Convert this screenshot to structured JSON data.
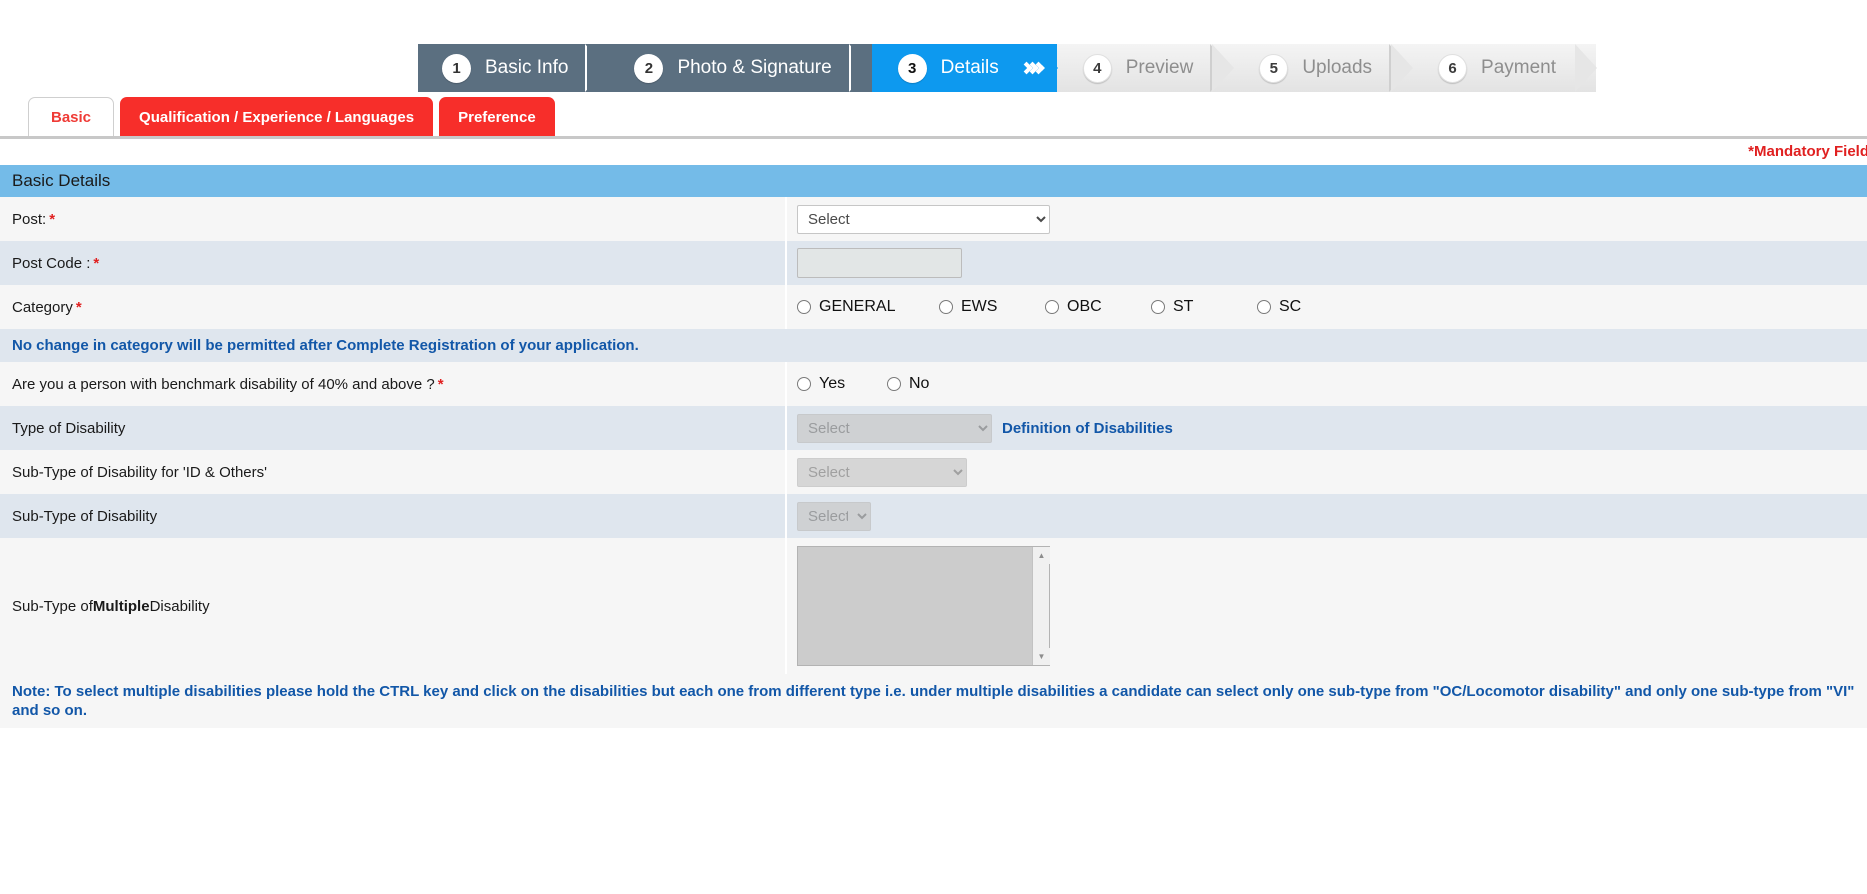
{
  "wizard": {
    "steps": [
      {
        "num": "1",
        "label": "Basic Info",
        "state": "done"
      },
      {
        "num": "2",
        "label": "Photo & Signature",
        "state": "done"
      },
      {
        "num": "3",
        "label": "Details",
        "state": "active"
      },
      {
        "num": "4",
        "label": "Preview",
        "state": "todo"
      },
      {
        "num": "5",
        "label": "Uploads",
        "state": "todo"
      },
      {
        "num": "6",
        "label": "Payment",
        "state": "todo"
      }
    ],
    "active_color": "#0d99ef",
    "done_color": "#5b6f80"
  },
  "tabs": [
    {
      "label": "Basic",
      "active": true
    },
    {
      "label": "Qualification / Experience / Languages",
      "active": false
    },
    {
      "label": "Preference",
      "active": false
    }
  ],
  "mandatory_note": "*Mandatory Field",
  "section": {
    "title": "Basic Details",
    "header_color": "#74bbe8"
  },
  "fields": {
    "post": {
      "label": "Post:",
      "required": "*",
      "selected": "Select",
      "options": [
        "Select"
      ]
    },
    "post_code": {
      "label": "Post Code :",
      "required": "*",
      "value": ""
    },
    "category": {
      "label": "Category",
      "required": "*",
      "options": [
        "GENERAL",
        "EWS",
        "OBC",
        "ST",
        "SC"
      ],
      "selected": ""
    },
    "category_note": "No change in category will be permitted after Complete Registration of your application.",
    "benchmark_disability": {
      "label": "Are you a person with benchmark disability of 40% and above ?",
      "required": "*",
      "options": [
        "Yes",
        "No"
      ],
      "selected": ""
    },
    "type_of_disability": {
      "label": "Type of Disability",
      "selected": "Select",
      "disabled": true,
      "link": "Definition of Disabilities"
    },
    "sub_type_id_others": {
      "label": "Sub-Type of Disability for 'ID & Others'",
      "selected": "Select",
      "disabled": true
    },
    "sub_type_disability": {
      "label": "Sub-Type of Disability",
      "selected": "Select",
      "disabled": true
    },
    "sub_type_multiple": {
      "label_pre": "Sub-Type of ",
      "label_bold": "Multiple",
      "label_post": " Disability",
      "items": []
    }
  },
  "bottom_note": "Note: To select multiple disabilities please hold the CTRL key and click on the disabilities but each one from different type i.e. under multiple disabilities a candidate can select only one sub-type from \"OC/Locomotor disability\" and only one sub-type from \"VI\" and so on."
}
